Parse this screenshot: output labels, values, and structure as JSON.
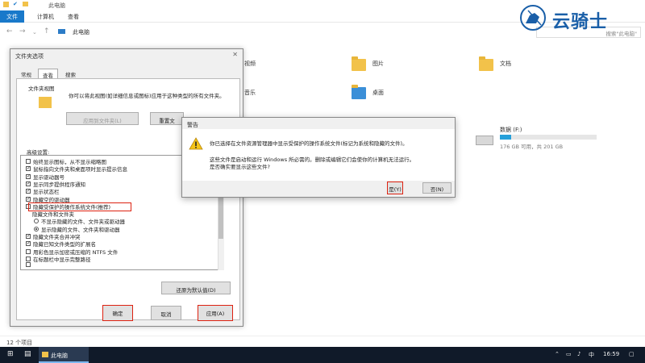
{
  "explorer": {
    "title": "此电脑",
    "ribbon_tabs": [
      "文件",
      "计算机",
      "查看"
    ],
    "breadcrumb": "此电脑",
    "search_placeholder": "搜索\"此电脑\"",
    "folders": [
      "视频",
      "图片",
      "文档",
      "音乐",
      "桌面"
    ],
    "drive": {
      "label": "数据 (F:)",
      "space": "176 GB 可用，共 201 GB",
      "used_fraction": 0.12
    },
    "status": "12 个项目"
  },
  "folder_options": {
    "title": "文件夹选项",
    "tabs": [
      "常规",
      "查看",
      "搜索"
    ],
    "group_folder_view": "文件夹视图",
    "folder_view_desc": "你可以将此视图(如详细信息或图标)应用于这种类型的所有文件夹。",
    "apply_to_folders": "应用到文件夹(L)",
    "reset_folders": "重置文",
    "advanced_label": "高级设置:",
    "options": [
      {
        "type": "cb",
        "checked": false,
        "text": "始终显示图标，从不显示缩略图"
      },
      {
        "type": "cb",
        "checked": true,
        "text": "鼠标指向文件夹和桌面项时显示提示信息"
      },
      {
        "type": "cb",
        "checked": true,
        "text": "显示驱动器号"
      },
      {
        "type": "cb",
        "checked": true,
        "text": "显示同步提供程序通知"
      },
      {
        "type": "cb",
        "checked": true,
        "text": "显示状态栏"
      },
      {
        "type": "cb",
        "checked": true,
        "text": "隐藏空的驱动器"
      },
      {
        "type": "cb",
        "checked": false,
        "text": "隐藏受保护的操作系统文件(推荐)"
      },
      {
        "type": "label",
        "text": "隐藏文件和文件夹"
      },
      {
        "type": "rb",
        "checked": false,
        "text": "不显示隐藏的文件、文件夹或驱动器"
      },
      {
        "type": "rb",
        "checked": true,
        "text": "显示隐藏的文件、文件夹和驱动器"
      },
      {
        "type": "cb",
        "checked": true,
        "text": "隐藏文件夹合并冲突"
      },
      {
        "type": "cb",
        "checked": true,
        "text": "隐藏已知文件类型的扩展名"
      },
      {
        "type": "cb",
        "checked": false,
        "text": "用彩色显示加密或压缩的 NTFS 文件"
      },
      {
        "type": "cb",
        "checked": false,
        "text": "在标题栏中显示完整路径"
      },
      {
        "type": "cb",
        "checked": false,
        "text": ""
      }
    ],
    "restore_defaults": "还原为默认值(D)",
    "ok": "确定",
    "cancel": "取消",
    "apply": "应用(A)"
  },
  "warning": {
    "title": "警告",
    "msg1": "你已选择在文件资源管理器中显示受保护的操作系统文件(标记为系统和隐藏的文件)。",
    "msg2": "这些文件是启动和运行 Windows 所必需的。删除或编辑它们会使你的计算机无法运行。",
    "msg3": "是否确实要显示这些文件?",
    "yes": "是(Y)",
    "no": "否(N)"
  },
  "taskbar": {
    "task": "此电脑",
    "time": "16:59",
    "ime": "中"
  },
  "watermark": "云骑士",
  "colors": {
    "accent": "#1979ca",
    "highlight_red": "#dd2211",
    "taskbar": "#101a29"
  }
}
